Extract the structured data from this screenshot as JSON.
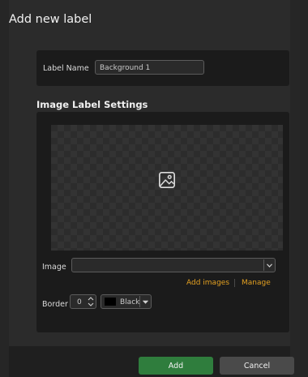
{
  "dialog": {
    "title": "Add new label",
    "label_name": {
      "label": "Label Name",
      "value": "Background 1"
    },
    "section_title": "Image Label Settings",
    "preview": {
      "icon": "image-icon"
    },
    "image": {
      "label": "Image",
      "value": "",
      "dropdown_icon": "chevron-down-icon"
    },
    "links": {
      "add_images": "Add images",
      "manage": "Manage"
    },
    "border": {
      "label": "Border",
      "value": "0",
      "color_swatch": "#000000",
      "color_name": "Black"
    },
    "buttons": {
      "add": "Add",
      "cancel": "Cancel"
    },
    "colors": {
      "accent_link": "#e3a021",
      "primary_button": "#2f7d3d"
    }
  }
}
